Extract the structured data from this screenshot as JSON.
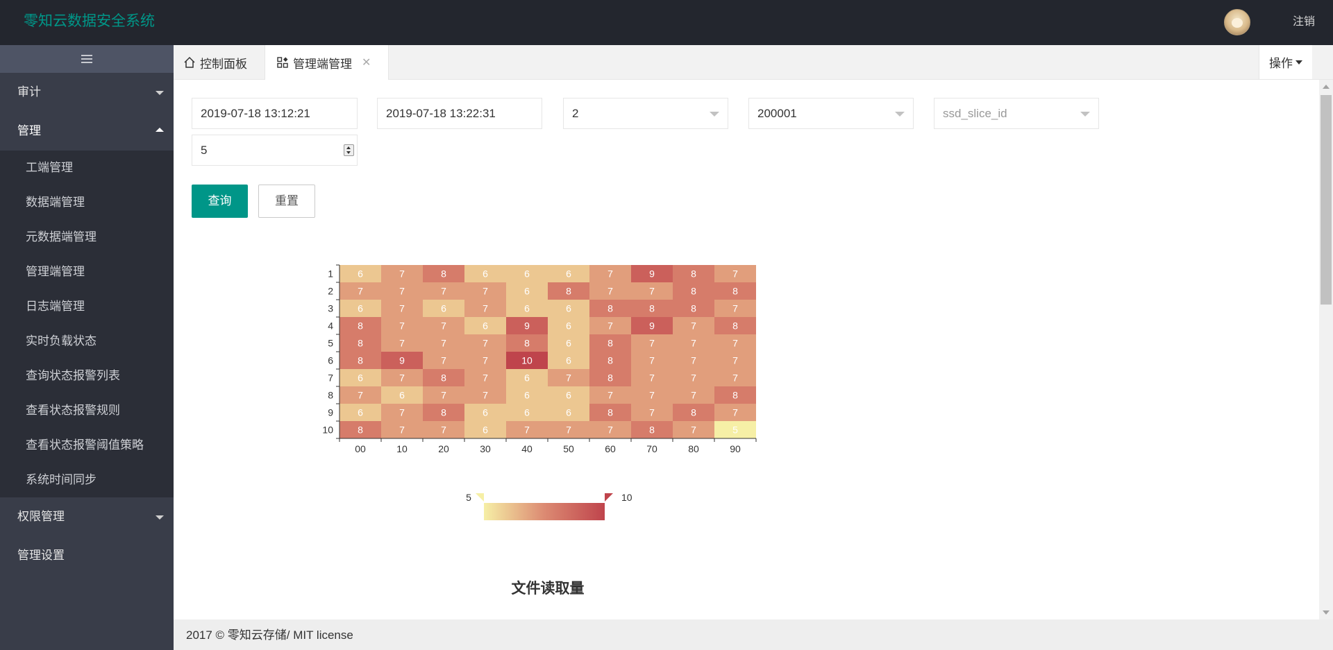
{
  "header": {
    "logo": "零知云数据安全系统",
    "logout": "注销"
  },
  "sidebar": {
    "groups": [
      {
        "label": "审计",
        "expanded": false
      },
      {
        "label": "管理",
        "expanded": true,
        "items": [
          "工端管理",
          "数据端管理",
          "元数据端管理",
          "管理端管理",
          "日志端管理",
          "实时负载状态",
          "查询状态报警列表",
          "查看状态报警规则",
          "查看状态报警阈值策略",
          "系统时间同步"
        ]
      },
      {
        "label": "权限管理",
        "expanded": false
      },
      {
        "label": "管理设置",
        "expanded": false
      }
    ]
  },
  "tabs": {
    "home": "控制面板",
    "active": "管理端管理",
    "close": "✕",
    "ops": "操作"
  },
  "form": {
    "start_time": "2019-07-18 13:12:21",
    "end_time": "2019-07-18 13:22:31",
    "select1": "2",
    "select2": "200001",
    "select3_placeholder": "ssd_slice_id",
    "number": "5",
    "query": "查询",
    "reset": "重置"
  },
  "footer": {
    "text": "2017 © 零知云存储/ MIT license"
  },
  "colors": {
    "accent": "#009688",
    "heat_low": "#f6efa6",
    "heat_high": "#bf444c"
  },
  "chart_data": {
    "type": "heatmap",
    "title": "文件读取量",
    "x": [
      "00",
      "10",
      "20",
      "30",
      "40",
      "50",
      "60",
      "70",
      "80",
      "90"
    ],
    "y": [
      "1",
      "2",
      "3",
      "4",
      "5",
      "6",
      "7",
      "8",
      "9",
      "10"
    ],
    "values": [
      [
        6,
        7,
        8,
        6,
        6,
        6,
        7,
        9,
        8,
        7
      ],
      [
        7,
        7,
        7,
        7,
        6,
        8,
        7,
        7,
        8,
        8
      ],
      [
        6,
        7,
        6,
        7,
        6,
        6,
        8,
        8,
        8,
        7
      ],
      [
        8,
        7,
        7,
        6,
        9,
        6,
        7,
        9,
        7,
        8
      ],
      [
        8,
        7,
        7,
        7,
        8,
        6,
        8,
        7,
        7,
        7
      ],
      [
        8,
        9,
        7,
        7,
        10,
        6,
        8,
        7,
        7,
        7
      ],
      [
        6,
        7,
        8,
        7,
        6,
        7,
        8,
        7,
        7,
        7
      ],
      [
        7,
        6,
        7,
        7,
        6,
        6,
        7,
        7,
        7,
        8
      ],
      [
        6,
        7,
        8,
        6,
        6,
        6,
        8,
        7,
        8,
        7
      ],
      [
        8,
        7,
        7,
        6,
        7,
        7,
        7,
        8,
        7,
        5
      ]
    ],
    "visual_map": {
      "min": 5,
      "max": 10,
      "min_label": "5",
      "max_label": "10"
    }
  }
}
